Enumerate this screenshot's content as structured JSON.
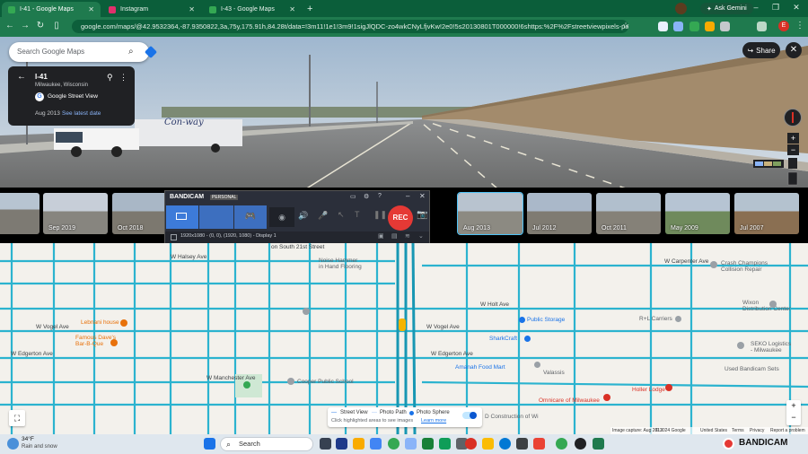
{
  "browser": {
    "tabs": [
      {
        "title": "I-41 - Google Maps",
        "favicon_color": "#34a853",
        "active": true
      },
      {
        "title": "Instagram",
        "favicon_color": "#e1306c",
        "active": false
      },
      {
        "title": "I-43 - Google Maps",
        "favicon_color": "#34a853",
        "active": false
      }
    ],
    "ask_gemini": "Ask Gemini",
    "url": "google.com/maps/@42.9532364,-87.9350822,3a,75y,175.91h,84.28t/data=!3m11!1e1!3m9!1sigJlQDC-zo4wkCNyLfjvKw!2e0!5s20130801T000000!6shttps:%2F%2Fstreetviewpixels-pa.googleapis.com%2Fv1%...",
    "profile_initial": "E"
  },
  "streetview": {
    "search_placeholder": "Search Google Maps",
    "location_title": "I-41",
    "location_subtitle": "Milwaukee, Wisconsin",
    "source_label": "Google Street View",
    "capture_date": "Aug 2013",
    "latest_date_link": "See latest date",
    "share_label": "Share",
    "truck_text": "Con-way"
  },
  "filmstrip": {
    "dates": [
      "",
      "Sep 2019",
      "Oct 2018",
      "",
      "",
      "",
      "",
      "Aug 2013",
      "Jul 2012",
      "Oct 2011",
      "May 2009",
      "Jul 2007"
    ],
    "selected": "Aug 2013"
  },
  "bandicam": {
    "brand": "BANDICAM",
    "edition": "PERSONAL",
    "rec_label": "REC",
    "resolution": "1920x1080 - (0, 0), (1920, 1080) - Display 1"
  },
  "map": {
    "streets": [
      "W Halsey Ave",
      "W Vogel Ave",
      "W Edgerton Ave",
      "W Manchester Ave",
      "W Carpenter Ave",
      "S 27th St",
      "S 26th St",
      "S 24th St",
      "S 22nd St",
      "S 20th St",
      "S 19th St",
      "S 18th St",
      "S 16th St",
      "S 13th St",
      "S 10th St",
      "S 6th St",
      "S 5th St",
      "W Holt Ave",
      "W Vogel Ave",
      "W Edgerton Ave",
      "on South 21st Street"
    ],
    "pois": [
      {
        "name": "Noise Hammer\nin Hand Flooring",
        "color": "#5f6368"
      },
      {
        "name": "Lebnani house",
        "color": "#e8710a"
      },
      {
        "name": "Famous Dave's\nBar-B-Que",
        "color": "#e8710a"
      },
      {
        "name": "Cooper Public School",
        "color": "#5f6368"
      },
      {
        "name": "Public Storage",
        "color": "#1a73e8"
      },
      {
        "name": "SharkCraft",
        "color": "#1a73e8"
      },
      {
        "name": "Amanah Food Mart",
        "color": "#1a73e8"
      },
      {
        "name": "Valassis",
        "color": "#5f6368"
      },
      {
        "name": "Omnicare of Milwaukee",
        "color": "#d93025"
      },
      {
        "name": "Holler Lodge",
        "color": "#d93025"
      },
      {
        "name": "Crash Champions\nCollision Repair",
        "color": "#5f6368"
      },
      {
        "name": "Wixon\nDistribution Center",
        "color": "#5f6368"
      },
      {
        "name": "R+L Carriers",
        "color": "#5f6368"
      },
      {
        "name": "SEKO Logistics\n- Milwaukee",
        "color": "#5f6368"
      },
      {
        "name": "Used Bandicam Sets",
        "color": "#5f6368"
      },
      {
        "name": "D Construction of Wi",
        "color": "#5f6368"
      }
    ],
    "legend": {
      "street_view": "Street View",
      "photo_path": "Photo Path",
      "photo_sphere": "Photo Sphere",
      "hint": "Click highlighted areas to see images",
      "learn_more": "Learn more"
    },
    "footer": [
      "Image capture: Aug 2013",
      "© 2024 Google",
      "United States",
      "Terms",
      "Privacy",
      "Report a problem"
    ]
  },
  "taskbar": {
    "weather_temp": "34°F",
    "weather_desc": "Rain and snow",
    "search_label": "Search",
    "tray_brand": "BANDICAM"
  }
}
